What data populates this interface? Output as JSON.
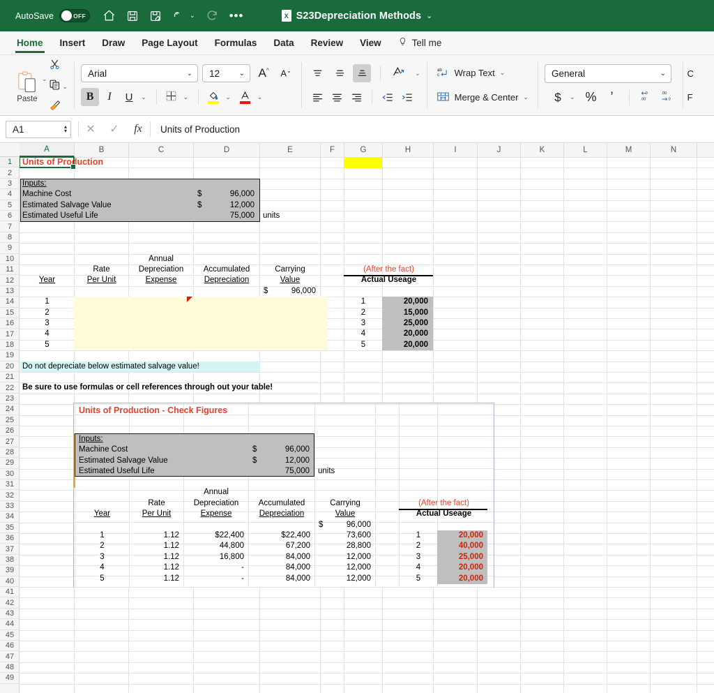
{
  "titlebar": {
    "autosave_label": "AutoSave",
    "autosave_state": "OFF",
    "doc_name": "S23Depreciation Methods",
    "icons": [
      "home-icon",
      "save-icon",
      "save-as-icon",
      "undo-icon",
      "redo-icon",
      "more-icon"
    ]
  },
  "ribbon_tabs": [
    {
      "label": "Home",
      "active": true
    },
    {
      "label": "Insert",
      "active": false
    },
    {
      "label": "Draw",
      "active": false
    },
    {
      "label": "Page Layout",
      "active": false
    },
    {
      "label": "Formulas",
      "active": false
    },
    {
      "label": "Data",
      "active": false
    },
    {
      "label": "Review",
      "active": false
    },
    {
      "label": "View",
      "active": false
    },
    {
      "label": "Tell me",
      "active": false
    }
  ],
  "ribbon": {
    "paste_label": "Paste",
    "font_name": "Arial",
    "font_size": "12",
    "bold_on": true,
    "wrap_text_label": "Wrap Text",
    "merge_center_label": "Merge & Center",
    "number_format": "General",
    "accent_green": "#1a6b3c",
    "highlight_color": "#ffff00",
    "font_color": "#e01b00"
  },
  "formula_bar": {
    "name_box": "A1",
    "formula": "Units of Production"
  },
  "grid": {
    "columns": [
      "A",
      "B",
      "C",
      "D",
      "E",
      "F",
      "G",
      "H",
      "I",
      "J",
      "K",
      "L",
      "M",
      "N"
    ],
    "selected_column": "A",
    "selected_row": 1,
    "rows": [
      1,
      2,
      3,
      4,
      5,
      6,
      7,
      8,
      9,
      10,
      11,
      12,
      13,
      14,
      15,
      16,
      17,
      18,
      19,
      20,
      21,
      22,
      23,
      24,
      25,
      26,
      27,
      28,
      29,
      30,
      31,
      32,
      33,
      34,
      35,
      36,
      37,
      38,
      39,
      40,
      41,
      42,
      43,
      44,
      45,
      46,
      47,
      48,
      49
    ],
    "highlight_cell": "G1",
    "highlight_cell_color": "#ffff00"
  },
  "sheet": {
    "title": "Units of Production",
    "inputs_header": "Inputs:",
    "inputs": [
      {
        "label": "Machine Cost",
        "symbol": "$",
        "value": "96,000",
        "unit": ""
      },
      {
        "label": "Estimated Salvage Value",
        "symbol": "$",
        "value": "12,000",
        "unit": ""
      },
      {
        "label": "Estimated Useful Life",
        "symbol": "",
        "value": "75,000",
        "unit": "units"
      }
    ],
    "table_headers": {
      "year": "Year",
      "rate_line1": "Rate",
      "rate_line2": "Per Unit",
      "annual_line1": "Annual",
      "annual_line2": "Depreciation",
      "annual_line3": "Expense",
      "accum_line1": "Accumulated",
      "accum_line2": "Depreciation",
      "carry_line1": "Carrying",
      "carry_line2": "Value",
      "after_fact": "(After the fact)",
      "actual_useage": "Actual Useage"
    },
    "opening_carrying": {
      "symbol": "$",
      "value": "96,000"
    },
    "years": [
      "1",
      "2",
      "3",
      "4",
      "5"
    ],
    "usage": [
      "20,000",
      "15,000",
      "25,000",
      "20,000",
      "20,000"
    ],
    "note_salvage": "Do not depreciate below estimated salvage value!",
    "note_formulas": "Be sure to use formulas or cell references through out your table!"
  },
  "check_figures": {
    "title": "Units of Production - Check Figures",
    "inputs_header": "Inputs:",
    "inputs": [
      {
        "label": "Machine Cost",
        "symbol": "$",
        "value": "96,000",
        "unit": ""
      },
      {
        "label": "Estimated Salvage Value",
        "symbol": "$",
        "value": "12,000",
        "unit": ""
      },
      {
        "label": "Estimated Useful Life",
        "symbol": "",
        "value": "75,000",
        "unit": "units"
      }
    ],
    "table_headers": {
      "year": "Year",
      "rate_line1": "Rate",
      "rate_line2": "Per Unit",
      "annual_line1": "Annual",
      "annual_line2": "Depreciation",
      "annual_line3": "Expense",
      "accum_line1": "Accumulated",
      "accum_line2": "Depreciation",
      "carry_line1": "Carrying",
      "carry_line2": "Value",
      "after_fact": "(After the fact)",
      "actual_useage": "Actual Useage"
    },
    "opening_carrying": {
      "symbol": "$",
      "value": "96,000"
    },
    "rows": [
      {
        "year": "1",
        "rate": "1.12",
        "expense": "$22,400",
        "accum": "$22,400",
        "carrying": "73,600",
        "u_year": "1",
        "usage": "20,000"
      },
      {
        "year": "2",
        "rate": "1.12",
        "expense": "44,800",
        "accum": "67,200",
        "carrying": "28,800",
        "u_year": "2",
        "usage": "40,000"
      },
      {
        "year": "3",
        "rate": "1.12",
        "expense": "16,800",
        "accum": "84,000",
        "carrying": "12,000",
        "u_year": "3",
        "usage": "25,000"
      },
      {
        "year": "4",
        "rate": "1.12",
        "expense": "-",
        "accum": "84,000",
        "carrying": "12,000",
        "u_year": "4",
        "usage": "20,000"
      },
      {
        "year": "5",
        "rate": "1.12",
        "expense": "-",
        "accum": "84,000",
        "carrying": "12,000",
        "u_year": "5",
        "usage": "20,000"
      }
    ]
  },
  "chart_data": {
    "type": "table",
    "title": "Units of Production - Check Figures",
    "columns": [
      "Year",
      "Rate Per Unit",
      "Annual Depreciation Expense",
      "Accumulated Depreciation",
      "Carrying Value",
      "Actual Useage"
    ],
    "rows": [
      [
        "1",
        "1.12",
        "$22,400",
        "$22,400",
        "73,600",
        "20,000"
      ],
      [
        "2",
        "1.12",
        "44,800",
        "67,200",
        "28,800",
        "40,000"
      ],
      [
        "3",
        "1.12",
        "16,800",
        "84,000",
        "12,000",
        "25,000"
      ],
      [
        "4",
        "1.12",
        "-",
        "84,000",
        "12,000",
        "20,000"
      ],
      [
        "5",
        "1.12",
        "-",
        "84,000",
        "12,000",
        "20,000"
      ]
    ]
  }
}
